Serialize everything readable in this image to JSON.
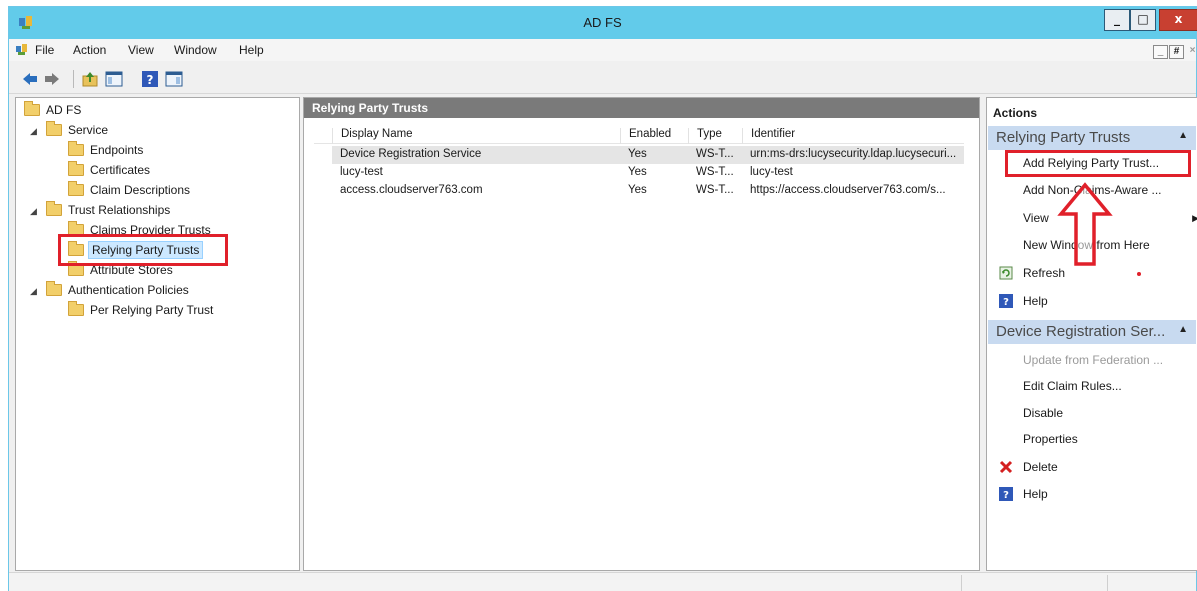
{
  "window": {
    "title": "AD FS",
    "minimize": "_",
    "maximize": "□",
    "close": "x"
  },
  "menu": {
    "items": [
      "File",
      "Action",
      "View",
      "Window",
      "Help"
    ],
    "mdi_min": "_",
    "mdi_restore": "#",
    "mdi_close": "×"
  },
  "tree": {
    "root": "AD FS",
    "service": "Service",
    "endpoints": "Endpoints",
    "certificates": "Certificates",
    "claim_descriptions": "Claim Descriptions",
    "trust_relationships": "Trust Relationships",
    "claims_provider_trusts": "Claims Provider Trusts",
    "relying_party_trusts": "Relying Party Trusts",
    "attribute_stores": "Attribute Stores",
    "authentication_policies": "Authentication Policies",
    "per_relying_party_trust": "Per Relying Party Trust"
  },
  "center": {
    "title": "Relying Party Trusts",
    "columns": {
      "display_name": "Display Name",
      "enabled": "Enabled",
      "type": "Type",
      "identifier": "Identifier"
    },
    "rows": [
      {
        "name": "Device Registration Service",
        "enabled": "Yes",
        "type": "WS-T...",
        "identifier": "urn:ms-drs:lucysecurity.ldap.lucysecuri..."
      },
      {
        "name": "lucy-test",
        "enabled": "Yes",
        "type": "WS-T...",
        "identifier": "lucy-test"
      },
      {
        "name": "access.cloudserver763.com",
        "enabled": "Yes",
        "type": "WS-T...",
        "identifier": "https://access.cloudserver763.com/s..."
      }
    ]
  },
  "actions": {
    "title": "Actions",
    "section1": {
      "header": "Relying Party Trusts",
      "items": {
        "add_rp_trust": "Add Relying Party Trust...",
        "add_non_claims": "Add Non-Claims-Aware ...",
        "view": "View",
        "new_window": "New Window from Here",
        "refresh": "Refresh",
        "help": "Help"
      }
    },
    "section2": {
      "header": "Device Registration Ser...",
      "items": {
        "update": "Update from Federation ...",
        "edit_claim_rules": "Edit Claim Rules...",
        "disable": "Disable",
        "properties": "Properties",
        "delete": "Delete",
        "help": "Help"
      }
    }
  },
  "colors": {
    "titlebar": "#62cbea",
    "highlight_red": "#e0202a",
    "section_header": "#c8daf0"
  }
}
